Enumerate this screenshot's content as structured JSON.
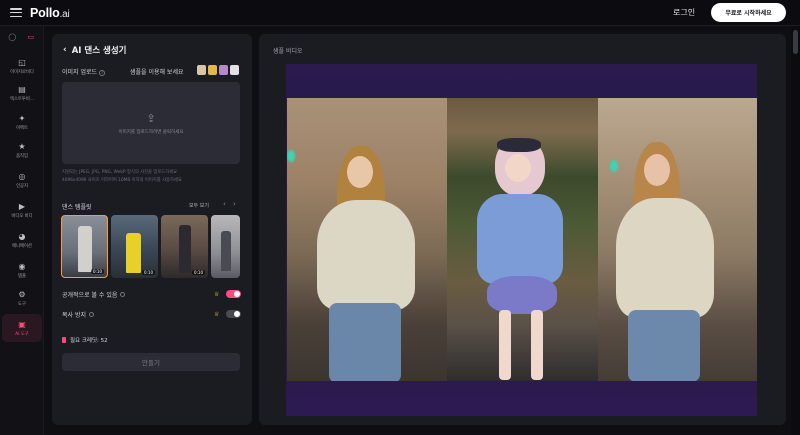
{
  "header": {
    "logo_main": "Pollo",
    "logo_suffix": ".ai",
    "login": "로그인",
    "start_button": "무료로 시작하세요"
  },
  "sidebar": {
    "items": [
      {
        "label": "이미지로비디",
        "icon": "image-video-icon"
      },
      {
        "label": "텍스트투비...",
        "icon": "text-video-icon"
      },
      {
        "label": "이펙트",
        "icon": "effects-icon"
      },
      {
        "label": "움직임",
        "icon": "motion-icon"
      },
      {
        "label": "인공지",
        "icon": "ai-icon"
      },
      {
        "label": "비디오 비디",
        "icon": "video-video-icon"
      },
      {
        "label": "애니메이션",
        "icon": "animation-icon"
      },
      {
        "label": "템플",
        "icon": "template-icon"
      },
      {
        "label": "도구",
        "icon": "tools-icon"
      },
      {
        "label": "AI 도구",
        "icon": "ai-tools-icon"
      }
    ]
  },
  "left_panel": {
    "title": "AI 댄스 생성기",
    "upload_label": "이미지 업로드",
    "sample_label": "샘플을 이용해 보세요",
    "drop_text": "이미지를 업로드하려면 클릭하세요",
    "hint_line1": "지원되는 JPEG, JPG, PNG, WebP 형식의 사진을 업로드하세요",
    "hint_line2": "4096x4096 사이즈 이하이며 10MB 이하의 이미지를 사용하세요",
    "dance_label": "댄스 템플릿",
    "view_all": "모두 보기",
    "dance_cards": [
      {
        "duration": "0:10"
      },
      {
        "duration": "0:10"
      },
      {
        "duration": "0:10"
      },
      {
        "duration": ""
      }
    ],
    "public_label": "공개적으로 볼 수 있음",
    "copy_protect_label": "복사 방지",
    "credits": "필요 크레딧: 52",
    "create_button": "만들기"
  },
  "right_panel": {
    "title": "샘플 비디오"
  },
  "colors": {
    "accent": "#ff4b7b",
    "toggle_on": "#ff4b7b",
    "toggle_off": "#4a4a54",
    "selected_border": "#ff9a30"
  }
}
